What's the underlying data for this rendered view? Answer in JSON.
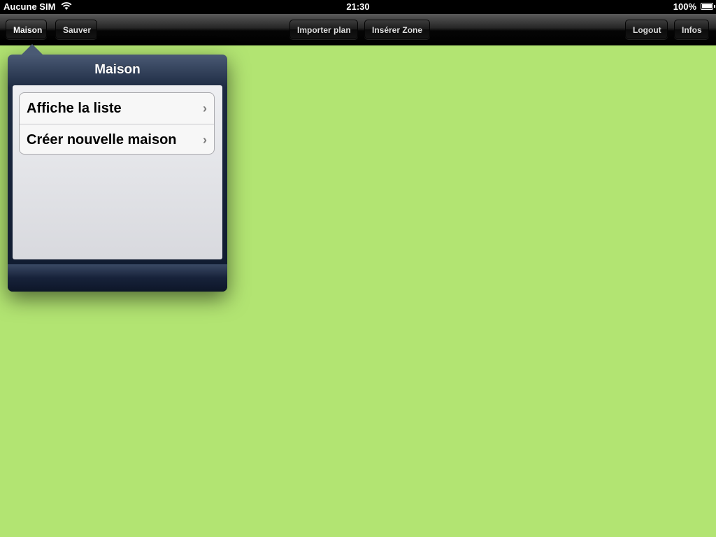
{
  "statusbar": {
    "carrier": "Aucune SIM",
    "time": "21:30",
    "battery": "100%"
  },
  "toolbar": {
    "maison": "Maison",
    "sauver": "Sauver",
    "importer_plan": "Importer plan",
    "inserer_zone": "Insérer Zone",
    "logout": "Logout",
    "infos": "Infos"
  },
  "popover": {
    "title": "Maison",
    "items": [
      {
        "label": "Affiche la liste"
      },
      {
        "label": "Créer nouvelle maison"
      }
    ]
  },
  "colors": {
    "background": "#b2e472",
    "popover": "#1d2a42"
  }
}
